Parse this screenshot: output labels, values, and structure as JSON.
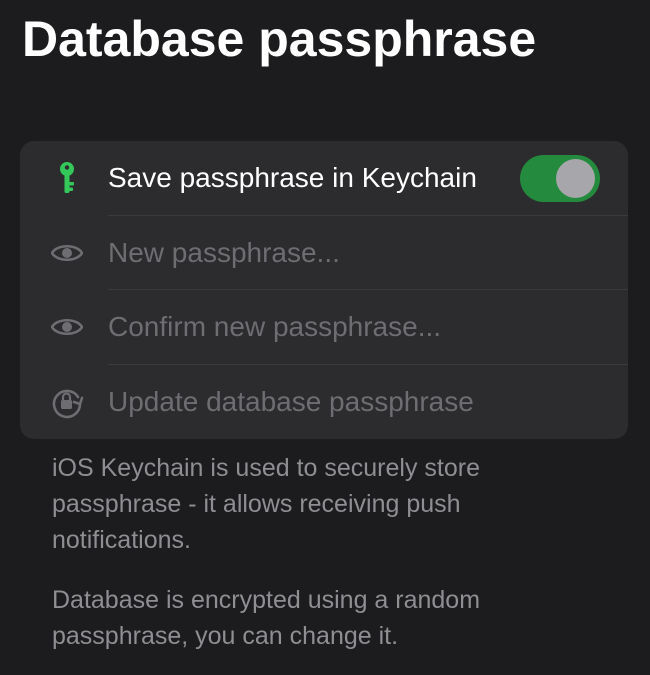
{
  "page": {
    "title": "Database passphrase"
  },
  "settings": {
    "keychain_row": {
      "label": "Save passphrase in Keychain",
      "icon": "key-icon",
      "toggle_on": true
    },
    "new_passphrase": {
      "placeholder": "New passphrase...",
      "icon": "eye-icon"
    },
    "confirm_passphrase": {
      "placeholder": "Confirm new passphrase...",
      "icon": "eye-icon"
    },
    "update_button": {
      "label": "Update database passphrase",
      "icon": "lock-rotate-icon"
    }
  },
  "footer": {
    "keychain_note": "iOS Keychain is used to securely store passphrase - it allows receiving push notifications.",
    "encryption_note": "Database is encrypted using a random passphrase, you can change it."
  },
  "colors": {
    "background": "#1c1c1e",
    "card": "#2c2c2e",
    "toggle_on": "#248a3d",
    "key_icon": "#34c759",
    "muted_text": "#6d6d72",
    "footer_text": "#8e8e93"
  }
}
